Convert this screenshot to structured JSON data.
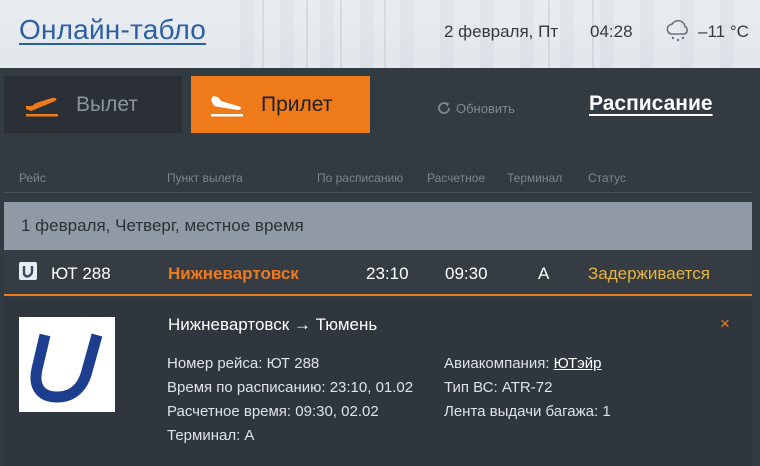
{
  "header": {
    "title": "Онлайн-табло",
    "date": "2 февраля, Пт",
    "time": "04:28",
    "weather_icon": "snow-cloud-icon",
    "temperature": "–11 °C"
  },
  "tabs": {
    "departure": {
      "label": "Вылет",
      "icon": "plane-takeoff-icon"
    },
    "arrival": {
      "label": "Прилет",
      "icon": "plane-landing-icon",
      "active": true
    }
  },
  "refresh": {
    "label": "Обновить",
    "icon": "refresh-icon"
  },
  "schedule_link": "Расписание",
  "columns": {
    "flight": "Рейс",
    "origin": "Пункт вылета",
    "scheduled": "По расписанию",
    "estimated": "Расчетное",
    "terminal": "Терминал",
    "status": "Статус"
  },
  "date_band": "1 февраля, Четверг, местное время",
  "flight": {
    "number": "ЮТ 288",
    "origin": "Нижневартовск",
    "scheduled": "23:10",
    "estimated": "09:30",
    "terminal": "A",
    "status": "Задерживается"
  },
  "details": {
    "route": "Нижневартовск → Тюмень",
    "flight_number": "Номер рейса: ЮТ 288",
    "scheduled": "Время по расписанию: 23:10, 01.02",
    "estimated": "Расчетное время: 09:30, 02.02",
    "terminal": "Терминал: A",
    "airline_label": "Авиакомпания: ",
    "airline_name": "ЮТэйр",
    "aircraft": "Тип ВС: ATR-72",
    "baggage": "Лента выдачи багажа: 1",
    "close": "×"
  },
  "colors": {
    "accent": "#ef7a1a",
    "status_delayed": "#e7b53a",
    "title_link": "#2d5fa5",
    "panel_bg": "#333b42"
  }
}
